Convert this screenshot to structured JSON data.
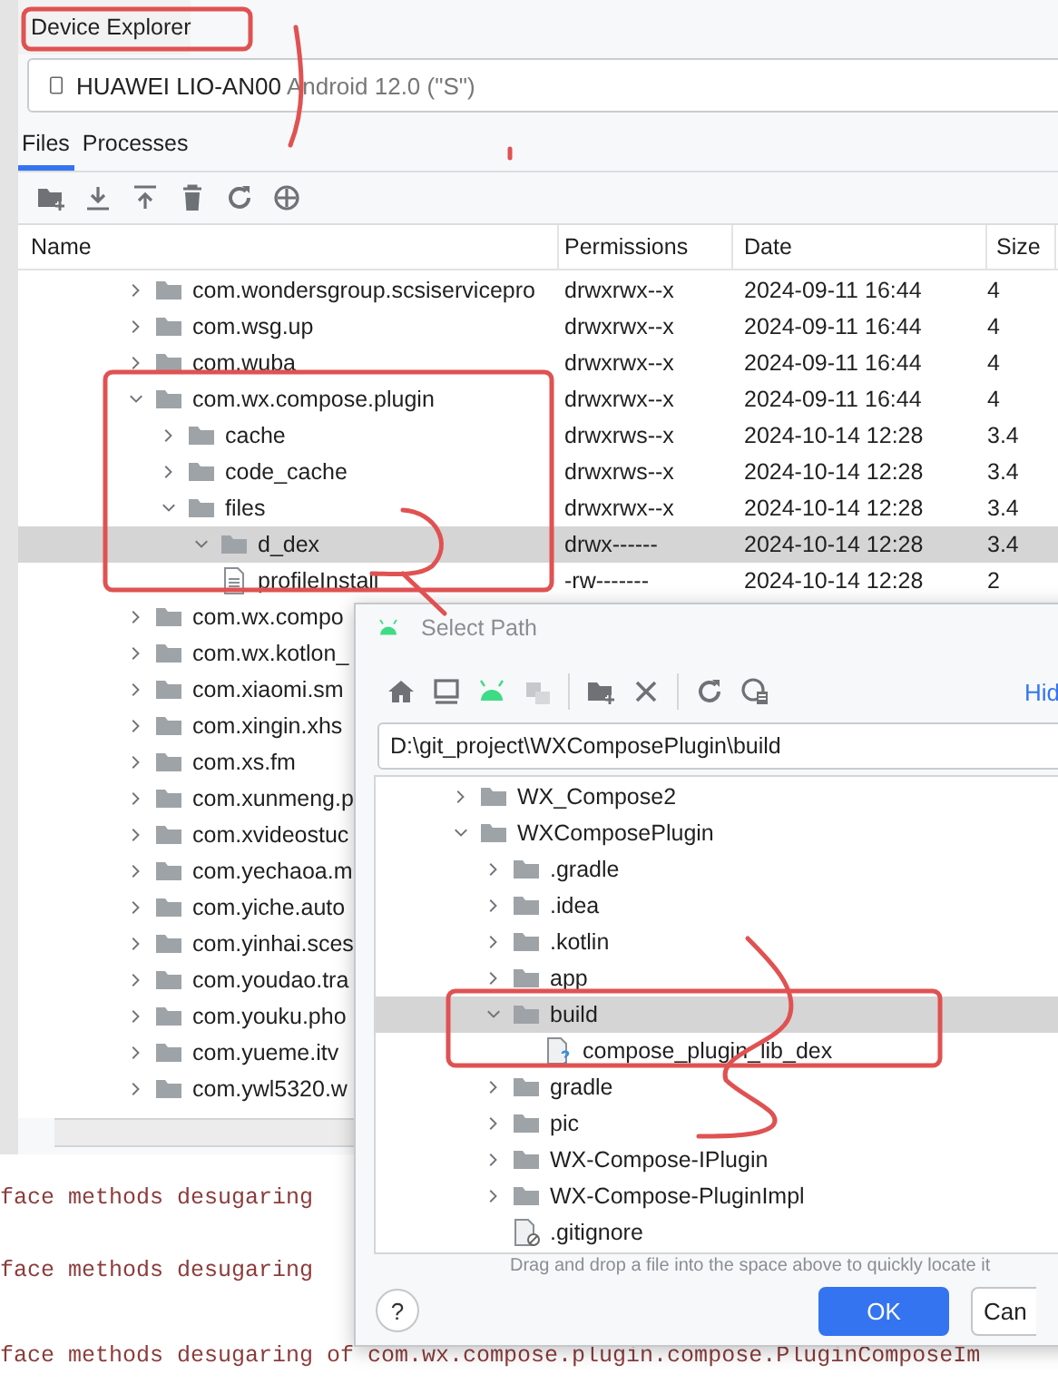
{
  "panel": {
    "title": "Device Explorer"
  },
  "device": {
    "name": "HUAWEI LIO-AN00",
    "detail": "Android 12.0 (\"S\")"
  },
  "tabs": [
    {
      "label": "Files",
      "selected": true
    },
    {
      "label": "Processes",
      "selected": false
    }
  ],
  "columns": [
    "Name",
    "Permissions",
    "Date",
    "Size"
  ],
  "files": [
    {
      "kind": "folder",
      "name": "com.wondersgroup.scsiservicepro",
      "permissions": "drwxrwx--x",
      "date": "2024-09-11 16:44",
      "size": "4",
      "expanded": false,
      "selected": false
    },
    {
      "kind": "folder",
      "name": "com.wsg.up",
      "permissions": "drwxrwx--x",
      "date": "2024-09-11 16:44",
      "size": "4",
      "expanded": false,
      "selected": false
    },
    {
      "kind": "folder",
      "name": "com.wuba",
      "permissions": "drwxrwx--x",
      "date": "2024-09-11 16:44",
      "size": "4",
      "expanded": false,
      "selected": false
    },
    {
      "kind": "folder",
      "name": "com.wx.compose.plugin",
      "permissions": "drwxrwx--x",
      "date": "2024-09-11 16:44",
      "size": "4",
      "expanded": true,
      "selected": false,
      "children": [
        {
          "kind": "folder",
          "name": "cache",
          "permissions": "drwxrws--x",
          "date": "2024-10-14 12:28",
          "size": "3.4",
          "expanded": false,
          "selected": false
        },
        {
          "kind": "folder",
          "name": "code_cache",
          "permissions": "drwxrws--x",
          "date": "2024-10-14 12:28",
          "size": "3.4",
          "expanded": false,
          "selected": false
        },
        {
          "kind": "folder",
          "name": "files",
          "permissions": "drwxrwx--x",
          "date": "2024-10-14 12:28",
          "size": "3.4",
          "expanded": true,
          "selected": false,
          "children": [
            {
              "kind": "folder",
              "name": "d_dex",
              "permissions": "drwx------",
              "date": "2024-10-14 12:28",
              "size": "3.4",
              "expanded": true,
              "selected": true
            },
            {
              "kind": "file",
              "name": "profileInstall",
              "permissions": "-rw-------",
              "date": "2024-10-14 12:28",
              "size": "2",
              "selected": false
            }
          ]
        }
      ]
    },
    {
      "kind": "folder",
      "name": "com.wx.compo",
      "expanded": false,
      "selected": false
    },
    {
      "kind": "folder",
      "name": "com.wx.kotlon_",
      "expanded": false,
      "selected": false
    },
    {
      "kind": "folder",
      "name": "com.xiaomi.sm",
      "expanded": false,
      "selected": false
    },
    {
      "kind": "folder",
      "name": "com.xingin.xhs",
      "expanded": false,
      "selected": false
    },
    {
      "kind": "folder",
      "name": "com.xs.fm",
      "expanded": false,
      "selected": false
    },
    {
      "kind": "folder",
      "name": "com.xunmeng.p",
      "expanded": false,
      "selected": false
    },
    {
      "kind": "folder",
      "name": "com.xvideostuc",
      "expanded": false,
      "selected": false
    },
    {
      "kind": "folder",
      "name": "com.yechaoa.m",
      "expanded": false,
      "selected": false
    },
    {
      "kind": "folder",
      "name": "com.yiche.auto",
      "expanded": false,
      "selected": false
    },
    {
      "kind": "folder",
      "name": "com.yinhai.sces",
      "expanded": false,
      "selected": false
    },
    {
      "kind": "folder",
      "name": "com.youdao.tra",
      "expanded": false,
      "selected": false
    },
    {
      "kind": "folder",
      "name": "com.youku.pho",
      "expanded": false,
      "selected": false
    },
    {
      "kind": "folder",
      "name": "com.yueme.itv",
      "expanded": false,
      "selected": false
    },
    {
      "kind": "folder",
      "name": "com.ywl5320.w",
      "expanded": false,
      "selected": false
    }
  ],
  "console": [
    "face methods desugaring",
    "face methods desugaring",
    "face methods desugaring of  com.wx.compose.plugin.compose.PluginComposeIm"
  ],
  "dialog": {
    "title": "Select Path",
    "hide_link": "Hid",
    "path": "D:\\git_project\\WXComposePlugin\\build",
    "tree": [
      {
        "kind": "folder",
        "name": "WX_Compose2",
        "expanded": false,
        "selected": false
      },
      {
        "kind": "folder",
        "name": "WXComposePlugin",
        "expanded": true,
        "selected": false,
        "children": [
          {
            "kind": "folder",
            "name": ".gradle",
            "expanded": false,
            "selected": false
          },
          {
            "kind": "folder",
            "name": ".idea",
            "expanded": false,
            "selected": false
          },
          {
            "kind": "folder",
            "name": ".kotlin",
            "expanded": false,
            "selected": false
          },
          {
            "kind": "folder",
            "name": "app",
            "expanded": false,
            "selected": false
          },
          {
            "kind": "folder",
            "name": "build",
            "expanded": true,
            "selected": true,
            "children": [
              {
                "kind": "unknown-file",
                "name": "compose_plugin_lib_dex",
                "selected": false
              }
            ]
          },
          {
            "kind": "folder",
            "name": "gradle",
            "expanded": false,
            "selected": false
          },
          {
            "kind": "folder",
            "name": "pic",
            "expanded": false,
            "selected": false
          },
          {
            "kind": "folder",
            "name": "WX-Compose-IPlugin",
            "expanded": false,
            "selected": false
          },
          {
            "kind": "folder",
            "name": "WX-Compose-PluginImpl",
            "expanded": false,
            "selected": false
          },
          {
            "kind": "ignored-file",
            "name": ".gitignore",
            "selected": false
          }
        ]
      }
    ],
    "hint": "Drag and drop a file into the space above to quickly locate it",
    "help": "?",
    "buttons": [
      {
        "label": "OK",
        "kind": "primary"
      },
      {
        "label": "Can",
        "kind": "secondary"
      }
    ]
  }
}
